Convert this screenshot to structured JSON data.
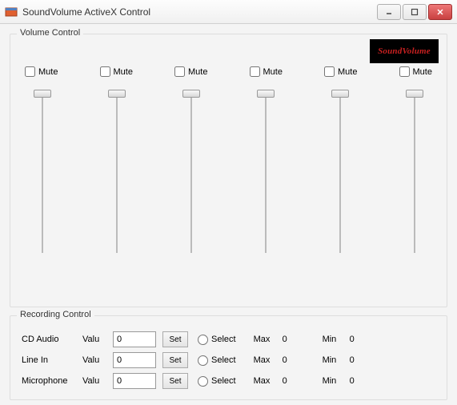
{
  "window": {
    "title": "SoundVolume ActiveX Control"
  },
  "logo": {
    "text": "SoundVolume"
  },
  "volume_control": {
    "title": "Volume Control",
    "mutes": [
      {
        "label": "Mute",
        "checked": false
      },
      {
        "label": "Mute",
        "checked": false
      },
      {
        "label": "Mute",
        "checked": false
      },
      {
        "label": "Mute",
        "checked": false
      },
      {
        "label": "Mute",
        "checked": false
      },
      {
        "label": "Mute",
        "checked": false
      }
    ]
  },
  "recording_control": {
    "title": "Recording Control",
    "value_label": "Valu",
    "set_label": "Set",
    "select_label": "Select",
    "max_label": "Max",
    "min_label": "Min",
    "rows": [
      {
        "name": "CD Audio",
        "value": "0",
        "max": "0",
        "min": "0"
      },
      {
        "name": "Line In",
        "value": "0",
        "max": "0",
        "min": "0"
      },
      {
        "name": "Microphone",
        "value": "0",
        "max": "0",
        "min": "0"
      }
    ]
  }
}
